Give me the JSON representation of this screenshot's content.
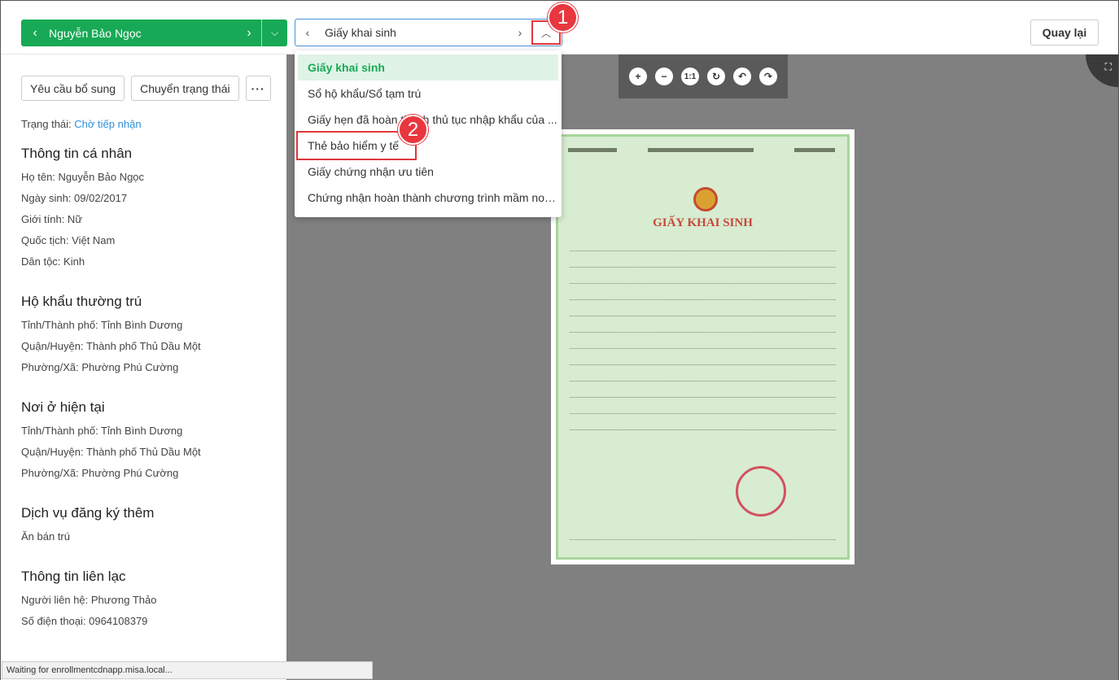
{
  "header": {
    "student_name": "Nguyễn Bảo Ngọc",
    "document_selected": "Giấy khai sinh",
    "back_label": "Quay lại",
    "annotation_1": "1",
    "annotation_2": "2"
  },
  "document_options": [
    "Giấy khai sinh",
    "Sổ hộ khẩu/Sổ tạm trú",
    "Giấy hẹn đã hoàn thành thủ tục nhập khẩu của ...",
    "Thẻ bảo hiểm y tế",
    "Giấy chứng nhận ưu tiên",
    "Chứng nhận hoàn thành chương trình mầm non..."
  ],
  "sidebar": {
    "request_more_label": "Yêu cầu bổ sung",
    "change_status_label": "Chuyển trạng thái",
    "more_label": "···",
    "status_label": "Trạng thái:",
    "status_value": "Chờ tiếp nhận",
    "personal": {
      "title": "Thông tin cá nhân",
      "rows": [
        "Họ tên: Nguyễn Bảo Ngọc",
        "Ngày sinh: 09/02/2017",
        "Giới tính: Nữ",
        "Quốc tịch: Việt Nam",
        "Dân tộc: Kinh"
      ]
    },
    "permanent": {
      "title": "Hộ khẩu thường trú",
      "rows": [
        "Tỉnh/Thành phố: Tỉnh Bình Dương",
        "Quận/Huyện: Thành phố Thủ Dầu Một",
        "Phường/Xã: Phường Phú Cường"
      ]
    },
    "current": {
      "title": "Nơi ở hiện tại",
      "rows": [
        "Tỉnh/Thành phố: Tỉnh Bình Dương",
        "Quận/Huyện: Thành phố Thủ Dầu Một",
        "Phường/Xã: Phường Phú Cường"
      ]
    },
    "services": {
      "title": "Dịch vụ đăng ký thêm",
      "rows": [
        "Ăn bán trú"
      ]
    },
    "contact": {
      "title": "Thông tin liên lạc",
      "rows": [
        "Người liên hệ: Phương Thảo",
        "Số điện thoại: 0964108379"
      ]
    }
  },
  "viewer": {
    "zoom_in": "+",
    "zoom_out": "−",
    "actual_size": "1:1",
    "refresh": "↻",
    "rotate_left": "↶",
    "rotate_right": "↷",
    "fullscreen": "⛶",
    "doc_title": "GIẤY KHAI SINH"
  },
  "statusbar": {
    "text": "Waiting for enrollmentcdnapp.misa.local..."
  }
}
